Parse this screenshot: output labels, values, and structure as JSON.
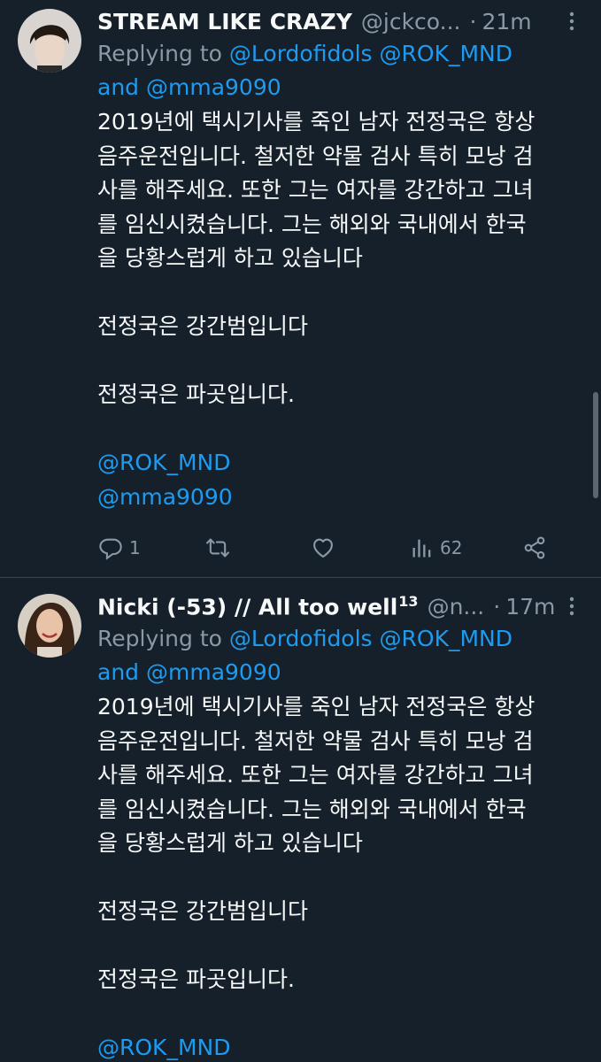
{
  "tweets": [
    {
      "display_name": "STREAM LIKE CRAZY",
      "handle": "@jckco...",
      "dot": "·",
      "time": "21m",
      "replying_prefix": "Replying to",
      "replying_to_1": "@Lordofidols",
      "replying_to_2": "@ROK_MND",
      "replying_and": "and",
      "replying_to_3": "@mma9090",
      "lines": [
        "2019년에 택시기사를 죽인 남자 전정국은 항상",
        "음주운전입니다. 철저한 약물 검사 특히 모낭 검",
        "사를 해주세요. 또한 그는 여자를 강간하고 그녀",
        "를 임신시켰습니다. 그는 해외와 국내에서 한국",
        "을 당황스럽게 하고 있습니다"
      ],
      "line2": "전정국은 강간범입니다",
      "line3": "전정국은 파곳입니다.",
      "mention_1": "@ROK_MND",
      "mention_2": "@mma9090",
      "reply_count": "1",
      "retweet_count": "",
      "like_count": "",
      "view_count": "62",
      "icons": [
        "more-icon",
        "reply-icon",
        "retweet-icon",
        "like-icon",
        "views-icon",
        "share-icon"
      ]
    },
    {
      "display_name": "Nicki (-53) // All too well",
      "display_name_sup": "13",
      "handle": "@n...",
      "dot": "·",
      "time": "17m",
      "replying_prefix": "Replying to",
      "replying_to_1": "@Lordofidols",
      "replying_to_2": "@ROK_MND",
      "replying_and": "and",
      "replying_to_3": "@mma9090",
      "lines": [
        "2019년에 택시기사를 죽인 남자 전정국은 항상",
        "음주운전입니다. 철저한 약물 검사 특히 모낭 검",
        "사를 해주세요. 또한 그는 여자를 강간하고 그녀",
        "를 임신시켰습니다. 그는 해외와 국내에서 한국",
        "을 당황스럽게 하고 있습니다"
      ],
      "line2": "전정국은 강간범입니다",
      "line3": "전정국은 파곳입니다.",
      "mention_1": "@ROK_MND"
    }
  ],
  "colors": {
    "background": "#15202b",
    "text": "#f7f9f9",
    "secondary": "#8b98a5",
    "link": "#1d9bf0",
    "divider": "#38444d"
  }
}
